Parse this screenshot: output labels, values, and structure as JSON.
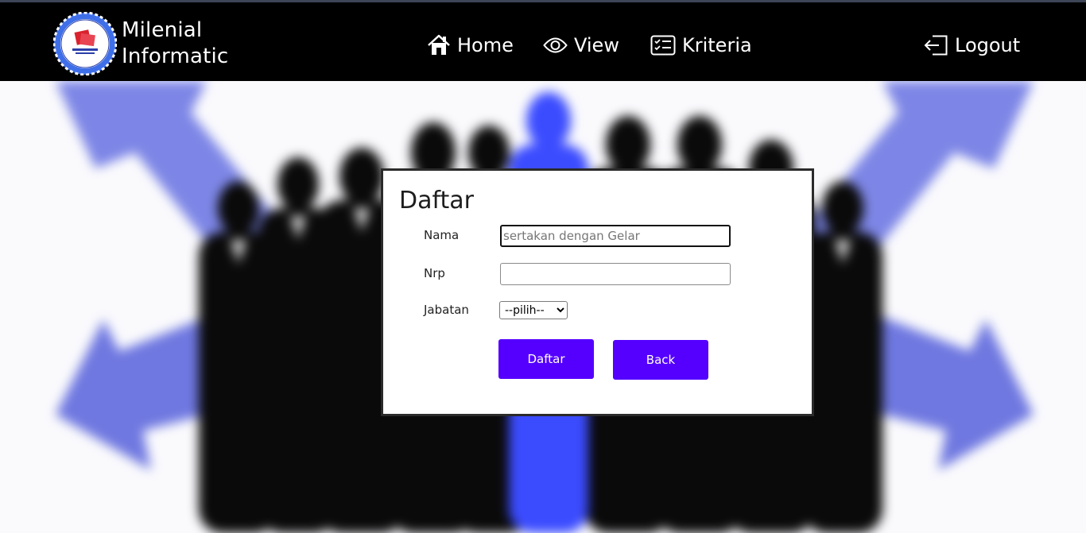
{
  "brand": {
    "line1": "Milenial",
    "line2": "Informatic",
    "logo_icon": "university-seal-icon"
  },
  "nav": {
    "home": {
      "label": "Home",
      "icon": "home-icon"
    },
    "view": {
      "label": "View",
      "icon": "eye-icon"
    },
    "kriteria": {
      "label": "Kriteria",
      "icon": "checklist-icon"
    },
    "logout": {
      "label": "Logout",
      "icon": "logout-icon"
    }
  },
  "form": {
    "title": "Daftar",
    "nama_label": "Nama",
    "nama_placeholder": "sertakan dengan Gelar",
    "nama_value": "",
    "nrp_label": "Nrp",
    "nrp_value": "",
    "jabatan_label": "Jabatan",
    "jabatan_selected": "--pilih--",
    "submit_label": "Daftar",
    "back_label": "Back"
  },
  "colors": {
    "navbar": "#000000",
    "button": "#5500ff",
    "accent_blue": "#3b5bff"
  }
}
